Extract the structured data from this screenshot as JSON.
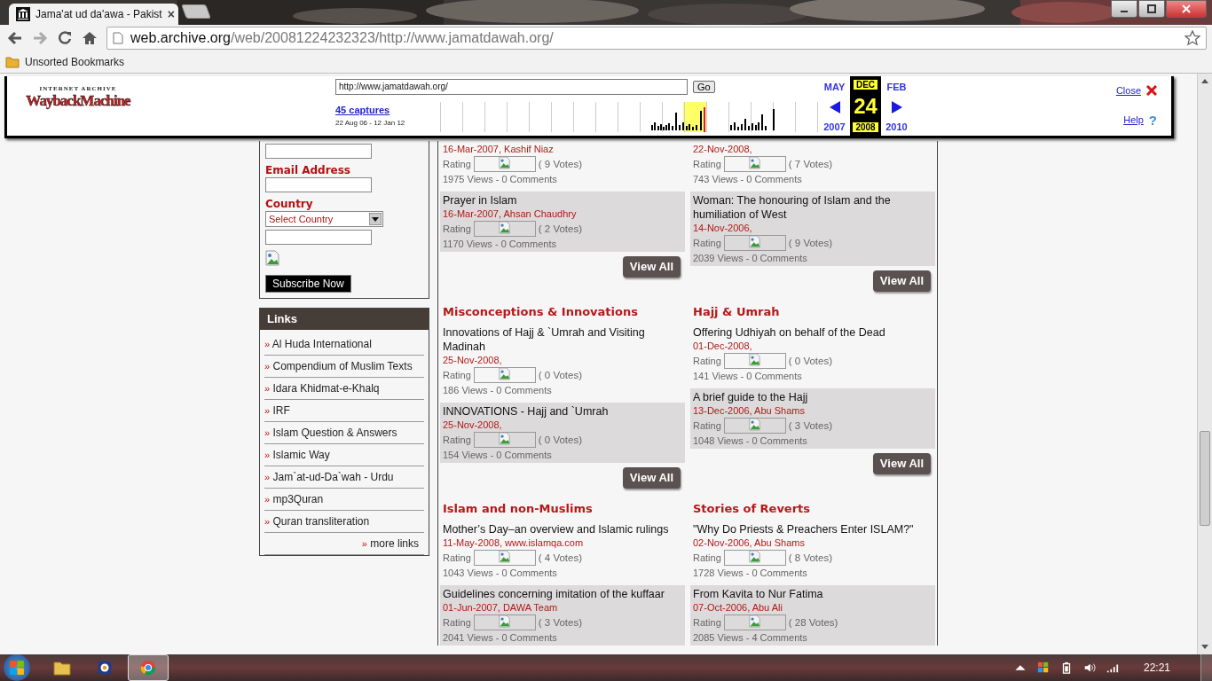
{
  "browser": {
    "tab_title": "Jama'at ud da'awa - Pakist",
    "tab_close": "×",
    "url_host": "web.archive.org",
    "url_path": "/web/20081224232323/http://www.jamatdawah.org/",
    "bookmarks": [
      "Unsorted Bookmarks"
    ]
  },
  "wayback": {
    "logo_top": "INTERNET ARCHIVE",
    "logo_main": "WaybackMachine",
    "url": "http://www.jamatdawah.org/",
    "go": "Go",
    "captures": "45 captures",
    "range": "22 Aug 06 - 12 Jan 12",
    "prev_month": "MAY",
    "month": "DEC",
    "next_month": "FEB",
    "prev_year": "2007",
    "day": "24",
    "year": "2008",
    "next_year": "2010",
    "close": "Close",
    "help": "Help",
    "help_icon": "?"
  },
  "subscribe": {
    "email_label": "Email Address",
    "country_label": "Country",
    "country_select": "Select Country",
    "button": "Subscribe Now"
  },
  "links": {
    "title": "Links",
    "items": [
      {
        "bullet": "»",
        "label": "Al Huda International"
      },
      {
        "bullet": "»",
        "label": "Compendium of Muslim Texts"
      },
      {
        "bullet": "»",
        "label": "Idara Khidmat-e-Khalq"
      },
      {
        "bullet": "»",
        "label": "IRF"
      },
      {
        "bullet": "»",
        "label": "Islam Question & Answers"
      },
      {
        "bullet": "»",
        "label": "Islamic Way"
      },
      {
        "bullet": "»",
        "label": "Jam`at-ud-Da`wah - Urdu"
      },
      {
        "bullet": "»",
        "label": "mp3Quran"
      },
      {
        "bullet": "»",
        "label": "Quran transliteration"
      }
    ],
    "more_bullet": "»",
    "more": "more links"
  },
  "rows": [
    [
      {
        "articles": [
          {
            "date": "16-Mar-2007, Kashif Niaz",
            "rating_label": "Rating",
            "votes": "( 9 Votes)",
            "stats": "1975 Views - 0 Comments"
          },
          {
            "title": "Prayer in Islam",
            "date": "16-Mar-2007, Ahsan Chaudhry",
            "rating_label": "Rating",
            "votes": "( 2 Votes)",
            "stats": "1170 Views - 0 Comments"
          }
        ],
        "button": "View All"
      },
      {
        "articles": [
          {
            "date": "22-Nov-2008,",
            "rating_label": "Rating",
            "votes": "( 7 Votes)",
            "stats": "743 Views - 0 Comments"
          },
          {
            "title": "Woman: The honouring of Islam and the humiliation of West",
            "date": "14-Nov-2006,",
            "rating_label": "Rating",
            "votes": "( 9 Votes)",
            "stats": "2039 Views - 0 Comments"
          }
        ],
        "button": "View All"
      }
    ],
    [
      {
        "title": "Misconceptions & Innovations",
        "articles": [
          {
            "title": "Innovations of Hajj & `Umrah and Visiting Madinah",
            "date": "25-Nov-2008,",
            "rating_label": "Rating",
            "votes": "( 0 Votes)",
            "stats": "186 Views - 0 Comments"
          },
          {
            "title": "INNOVATIONS - Hajj and `Umrah",
            "date": "25-Nov-2008,",
            "rating_label": "Rating",
            "votes": "( 0 Votes)",
            "stats": "154 Views - 0 Comments"
          }
        ],
        "button": "View All"
      },
      {
        "title": "Hajj & Umrah",
        "articles": [
          {
            "title": "Offering Udhiyah on behalf of the Dead",
            "date": "01-Dec-2008,",
            "rating_label": "Rating",
            "votes": "( 0 Votes)",
            "stats": "141 Views - 0 Comments"
          },
          {
            "title": "A brief guide to the Hajj",
            "date": "13-Dec-2006, Abu Shams",
            "rating_label": "Rating",
            "votes": "( 3 Votes)",
            "stats": "1048 Views - 0 Comments"
          }
        ],
        "button": "View All"
      }
    ],
    [
      {
        "title": "Islam and non-Muslims",
        "articles": [
          {
            "title": "Mother’s Day–an overview and Islamic rulings",
            "date": "11-May-2008, www.islamqa.com",
            "rating_label": "Rating",
            "votes": "( 4 Votes)",
            "stats": "1043 Views - 0 Comments"
          },
          {
            "title": "Guidelines concerning imitation of the kuffaar",
            "date": "01-Jun-2007, DAWA Team",
            "rating_label": "Rating",
            "votes": "( 3 Votes)",
            "stats": "2041 Views - 0 Comments"
          }
        ]
      },
      {
        "title": "Stories of Reverts",
        "articles": [
          {
            "title": "\"Why Do Priests & Preachers Enter ISLAM?\"",
            "date": "02-Nov-2006, Abu Shams",
            "rating_label": "Rating",
            "votes": "( 8 Votes)",
            "stats": "1728 Views - 0 Comments"
          },
          {
            "title": "From Kavita to Nur Fatima",
            "date": "07-Oct-2006, Abu Ali",
            "rating_label": "Rating",
            "votes": "( 28 Votes)",
            "stats": "2085 Views - 4 Comments"
          }
        ]
      }
    ]
  ],
  "taskbar": {
    "clock": "22:21"
  }
}
